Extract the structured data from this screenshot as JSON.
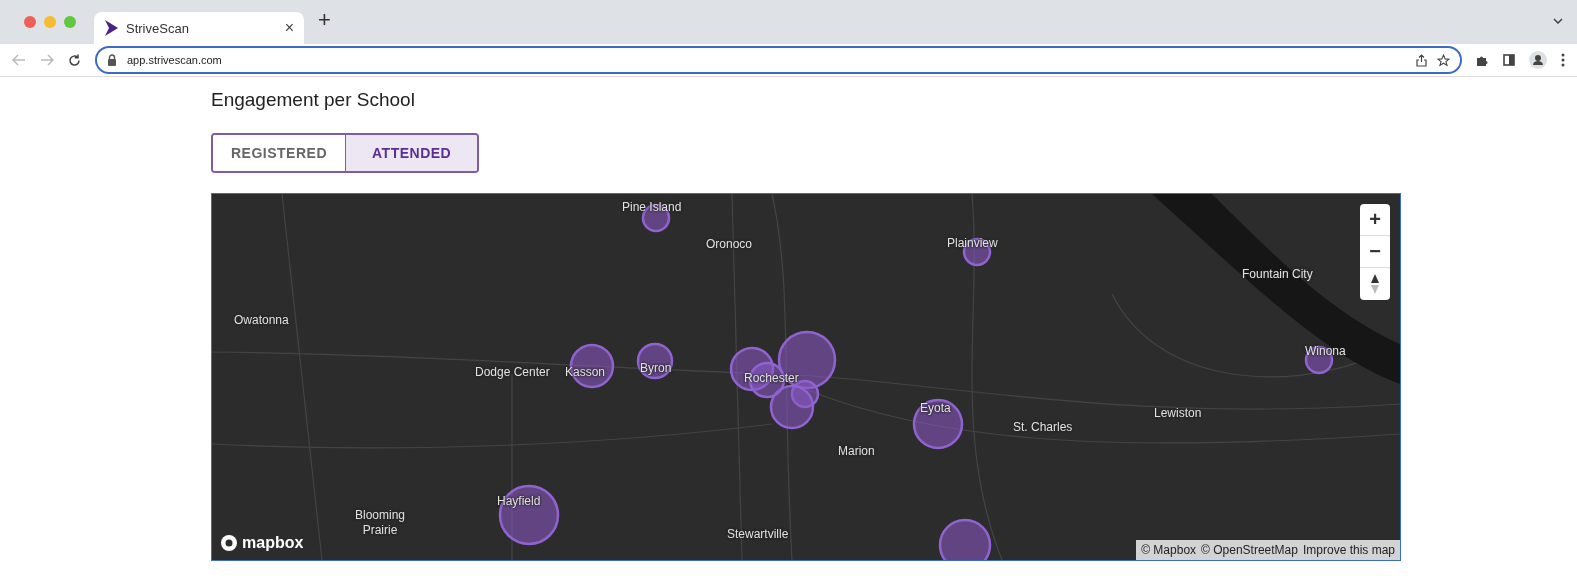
{
  "browser": {
    "tab": {
      "title": "StriveScan",
      "close": "×"
    },
    "new_tab": "+",
    "url": "app.strivescan.com"
  },
  "page": {
    "title": "Engagement per School",
    "toggle": [
      {
        "label": "REGISTERED",
        "selected": false
      },
      {
        "label": "ATTENDED",
        "selected": true
      }
    ],
    "map": {
      "places": [
        "Pine Island",
        "Oronoco",
        "Plainview",
        "Fountain City",
        "Owatonna",
        "Dodge Center",
        "Kasson",
        "Byron",
        "Rochester",
        "Winona",
        "Eyota",
        "St. Charles",
        "Lewiston",
        "Marion",
        "Hayfield",
        "Blooming Prairie",
        "Stewartville"
      ],
      "zoom_in": "+",
      "zoom_out": "−",
      "logo": "mapbox",
      "attribution": [
        "© Mapbox",
        "© OpenStreetMap",
        "Improve this map"
      ]
    }
  }
}
